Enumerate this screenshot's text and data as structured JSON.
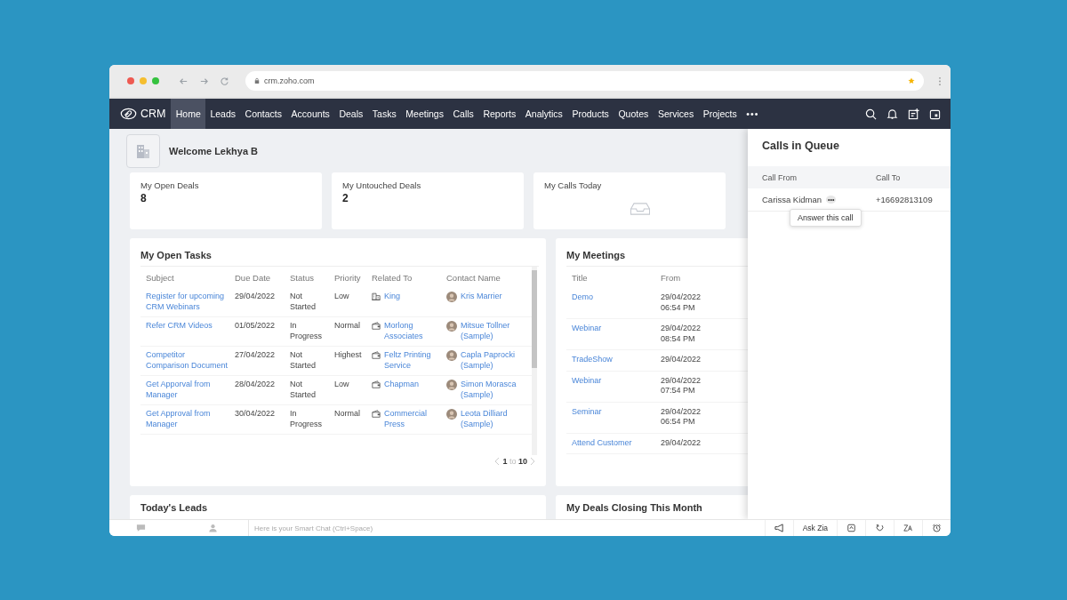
{
  "browser": {
    "url": "crm.zoho.com"
  },
  "nav": {
    "logo_text": "CRM",
    "more": "•••",
    "tabs": [
      {
        "label": "Home",
        "selected": true
      },
      {
        "label": "Leads",
        "selected": false
      },
      {
        "label": "Contacts",
        "selected": false
      },
      {
        "label": "Accounts",
        "selected": false
      },
      {
        "label": "Deals",
        "selected": false
      },
      {
        "label": "Tasks",
        "selected": false
      },
      {
        "label": "Meetings",
        "selected": false
      },
      {
        "label": "Calls",
        "selected": false
      },
      {
        "label": "Reports",
        "selected": false
      },
      {
        "label": "Analytics",
        "selected": false
      },
      {
        "label": "Products",
        "selected": false
      },
      {
        "label": "Quotes",
        "selected": false
      },
      {
        "label": "Services",
        "selected": false
      },
      {
        "label": "Projects",
        "selected": false
      }
    ]
  },
  "welcome": "Welcome Lekhya B",
  "stat_cards": [
    {
      "kind": "count",
      "title": "My Open Deals",
      "value": "8"
    },
    {
      "kind": "count",
      "title": "My Untouched Deals",
      "value": "2"
    },
    {
      "kind": "empty",
      "title": "My Calls Today"
    }
  ],
  "open_tasks": {
    "title": "My Open Tasks",
    "columns": [
      "Subject",
      "Due Date",
      "Status",
      "Priority",
      "Related To",
      "Contact Name"
    ],
    "rows": [
      {
        "subject": "Register for upcoming CRM Webinars",
        "due_date": "29/04/2022",
        "status": "Not Started",
        "priority": "Low",
        "related_to": {
          "kind": "account",
          "name": "King"
        },
        "contact_name": "Kris Marrier"
      },
      {
        "subject": "Refer CRM Videos",
        "due_date": "01/05/2022",
        "status": "In Progress",
        "priority": "Normal",
        "related_to": {
          "kind": "deal",
          "name": "Morlong Associates"
        },
        "contact_name": "Mitsue Tollner (Sample)"
      },
      {
        "subject": "Competitor Comparison Document",
        "due_date": "27/04/2022",
        "status": "Not Started",
        "priority": "Highest",
        "related_to": {
          "kind": "deal",
          "name": "Feltz Printing Service"
        },
        "contact_name": "Capla Paprocki (Sample)"
      },
      {
        "subject": "Get Apporval from Manager",
        "due_date": "28/04/2022",
        "status": "Not Started",
        "priority": "Low",
        "related_to": {
          "kind": "deal",
          "name": "Chapman"
        },
        "contact_name": "Simon Morasca (Sample)"
      },
      {
        "subject": "Get Approval from Manager",
        "due_date": "30/04/2022",
        "status": "In Progress",
        "priority": "Normal",
        "related_to": {
          "kind": "deal",
          "name": "Commercial Press"
        },
        "contact_name": "Leota Dilliard (Sample)"
      }
    ],
    "pagination": {
      "from": "1",
      "separator": "to",
      "to": "10"
    }
  },
  "meetings": {
    "title": "My Meetings",
    "columns": [
      "Title",
      "From"
    ],
    "rows": [
      {
        "title": "Demo",
        "from": "29/04/2022 06:54 PM"
      },
      {
        "title": "Webinar",
        "from": "29/04/2022 08:54 PM"
      },
      {
        "title": "TradeShow",
        "from": "29/04/2022"
      },
      {
        "title": "Webinar",
        "from": "29/04/2022 07:54 PM"
      },
      {
        "title": "Seminar",
        "from": "29/04/2022 06:54 PM"
      },
      {
        "title": "Attend Customer",
        "from": "29/04/2022"
      }
    ]
  },
  "lower_cards": [
    {
      "title": "Today's Leads"
    },
    {
      "title": "My Deals Closing This Month"
    }
  ],
  "calls_panel": {
    "title": "Calls in Queue",
    "columns": [
      "Call From",
      "Call To"
    ],
    "rows": [
      {
        "from": "Carissa Kidman",
        "more": "•••",
        "to": "+16692813109"
      }
    ],
    "tooltip": "Answer this call"
  },
  "bottom_bar": {
    "chat_placeholder": "Here is your Smart Chat (Ctrl+Space)",
    "zia_label": "Ask Zia"
  }
}
